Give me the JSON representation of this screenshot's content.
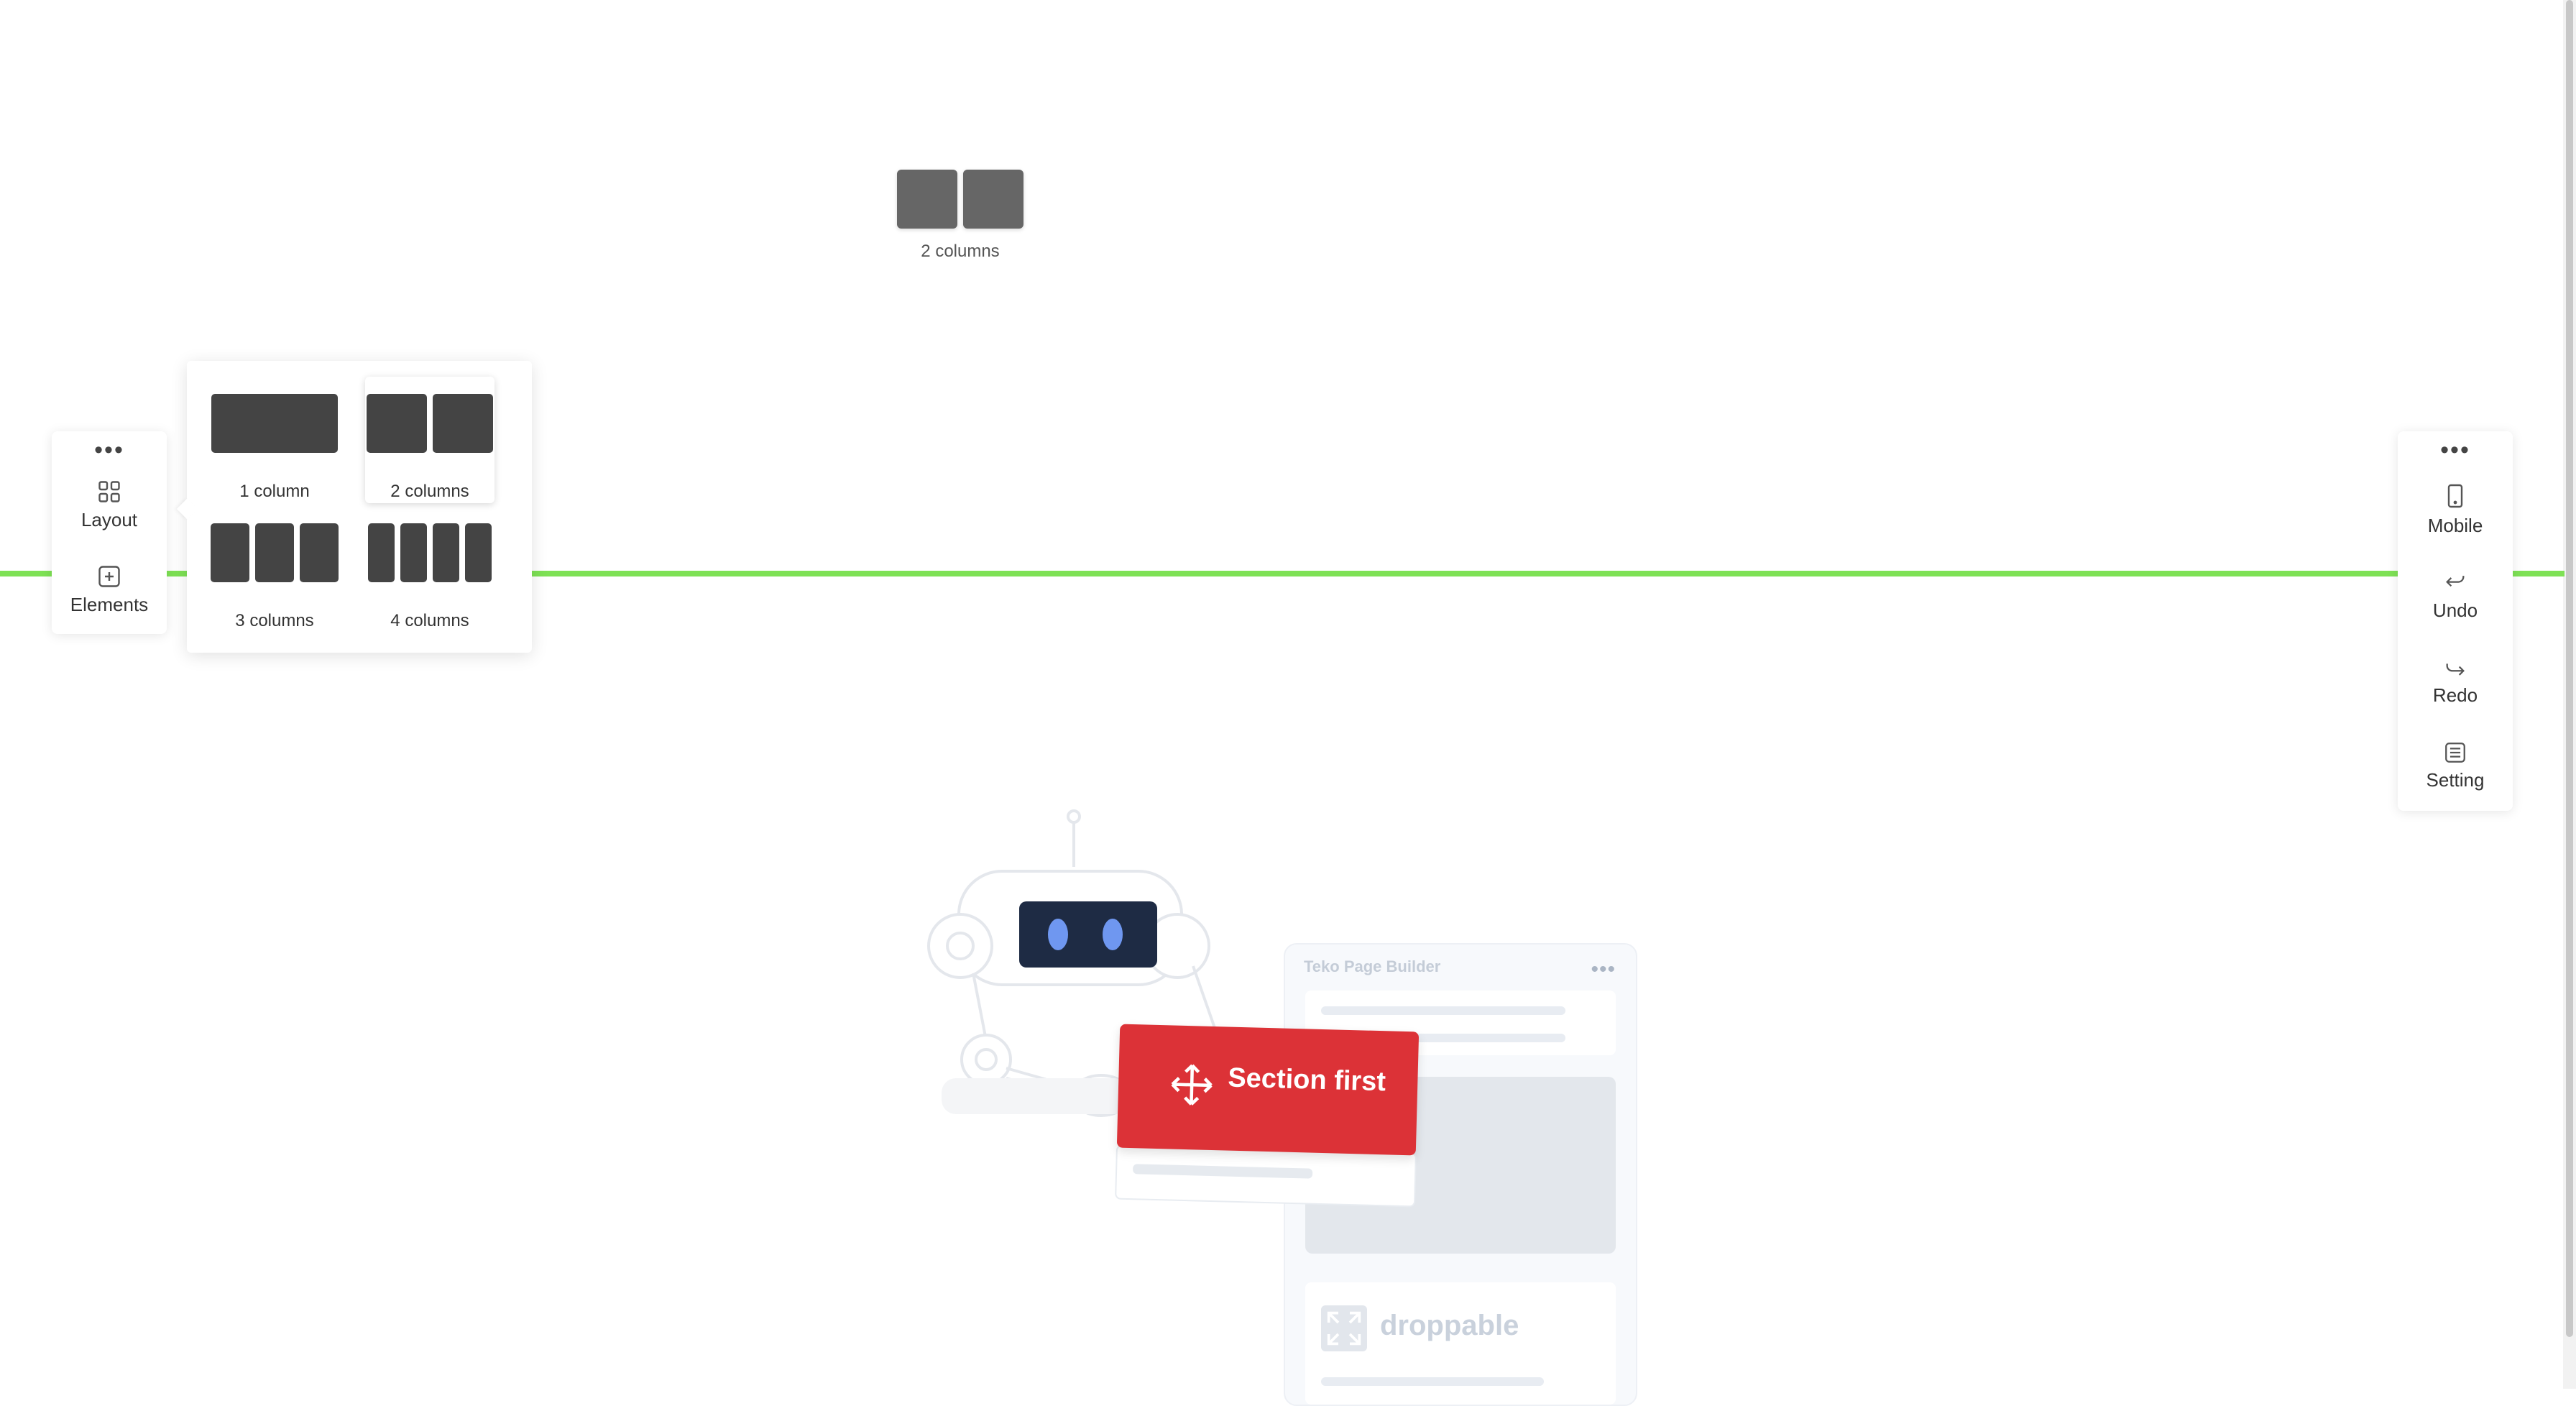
{
  "drag_preview": {
    "label": "2 columns"
  },
  "left_toolbar": {
    "more": "•••",
    "layout_label": "Layout",
    "elements_label": "Elements"
  },
  "layout_popover": {
    "options": [
      {
        "label": "1 column",
        "columns": 1
      },
      {
        "label": "2 columns",
        "columns": 2,
        "selected": true
      },
      {
        "label": "3 columns",
        "columns": 3
      },
      {
        "label": "4 columns",
        "columns": 4
      }
    ]
  },
  "right_toolbar": {
    "more": "•••",
    "mobile_label": "Mobile",
    "undo_label": "Undo",
    "redo_label": "Redo",
    "setting_label": "Setting"
  },
  "illustration": {
    "card_title": "Teko Page Builder",
    "badge_text": "Section first",
    "droppable_text": "droppable"
  },
  "colors": {
    "drop_line": "#7ee155",
    "badge": "#dc3237",
    "block": "#444444"
  }
}
